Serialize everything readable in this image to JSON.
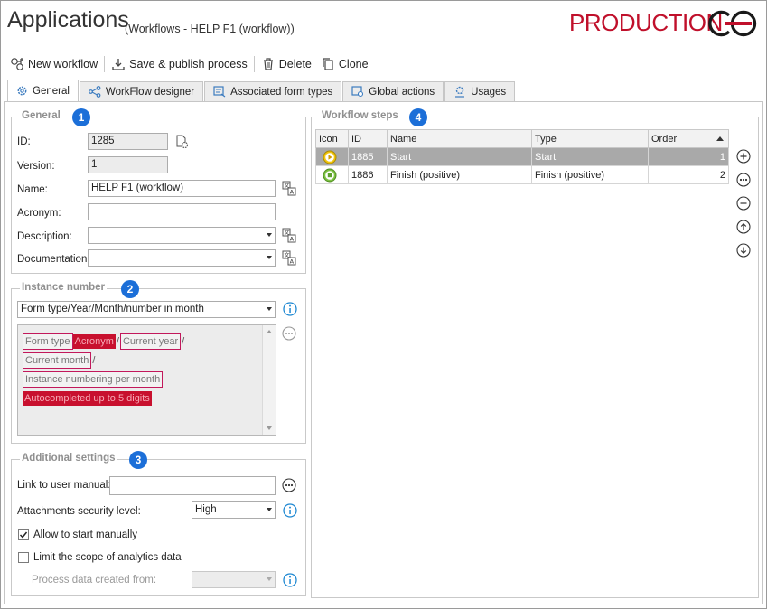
{
  "window": {
    "title": "Applications",
    "subtitle": "(Workflows - HELP F1 (workflow))",
    "environment": "PRODUCTION"
  },
  "toolbar": {
    "new_workflow": "New workflow",
    "save_publish": "Save & publish process",
    "delete": "Delete",
    "clone": "Clone"
  },
  "tabs": [
    "General",
    "WorkFlow designer",
    "Associated form types",
    "Global actions",
    "Usages"
  ],
  "general": {
    "title": "General",
    "badge": "1",
    "id_label": "ID:",
    "id_value": "1285",
    "version_label": "Version:",
    "version_value": "1",
    "name_label": "Name:",
    "name_value": "HELP F1 (workflow)",
    "acronym_label": "Acronym:",
    "acronym_value": "",
    "description_label": "Description:",
    "description_value": "",
    "documentation_label": "Documentation:",
    "documentation_value": ""
  },
  "instance": {
    "title": "Instance number",
    "badge": "2",
    "format_value": "Form type/Year/Month/number in month",
    "tags": {
      "form_type": "Form type",
      "acronym": "Acronym",
      "slash1": "/",
      "current_year": "Current year",
      "slash2": "/",
      "current_month": "Current month",
      "slash3": "/",
      "numbering": "Instance numbering per month",
      "autocompleted": "Autocompleted up to 5 digits"
    }
  },
  "additional": {
    "title": "Additional settings",
    "badge": "3",
    "manual_label": "Link to user manual:",
    "manual_value": "",
    "security_label": "Attachments security level:",
    "security_value": "High",
    "allow_start_label": "Allow to start manually",
    "allow_start_checked": true,
    "limit_scope_label": "Limit the scope of analytics data",
    "limit_scope_checked": false,
    "process_data_label": "Process data created from:",
    "process_data_value": ""
  },
  "steps": {
    "title": "Workflow steps",
    "badge": "4",
    "columns": [
      "Icon",
      "ID",
      "Name",
      "Type",
      "Order"
    ],
    "rows": [
      {
        "id": "1885",
        "name": "Start",
        "type": "Start",
        "order": "1",
        "icon": "start-step-icon",
        "selected": true
      },
      {
        "id": "1886",
        "name": "Finish (positive)",
        "type": "Finish (positive)",
        "order": "2",
        "icon": "finish-positive-step-icon",
        "selected": false
      }
    ]
  },
  "colors": {
    "brand": "#c0102b",
    "badge": "#1c6fd8",
    "info": "#1e88d2",
    "selected_row": "#a9a9a9"
  }
}
